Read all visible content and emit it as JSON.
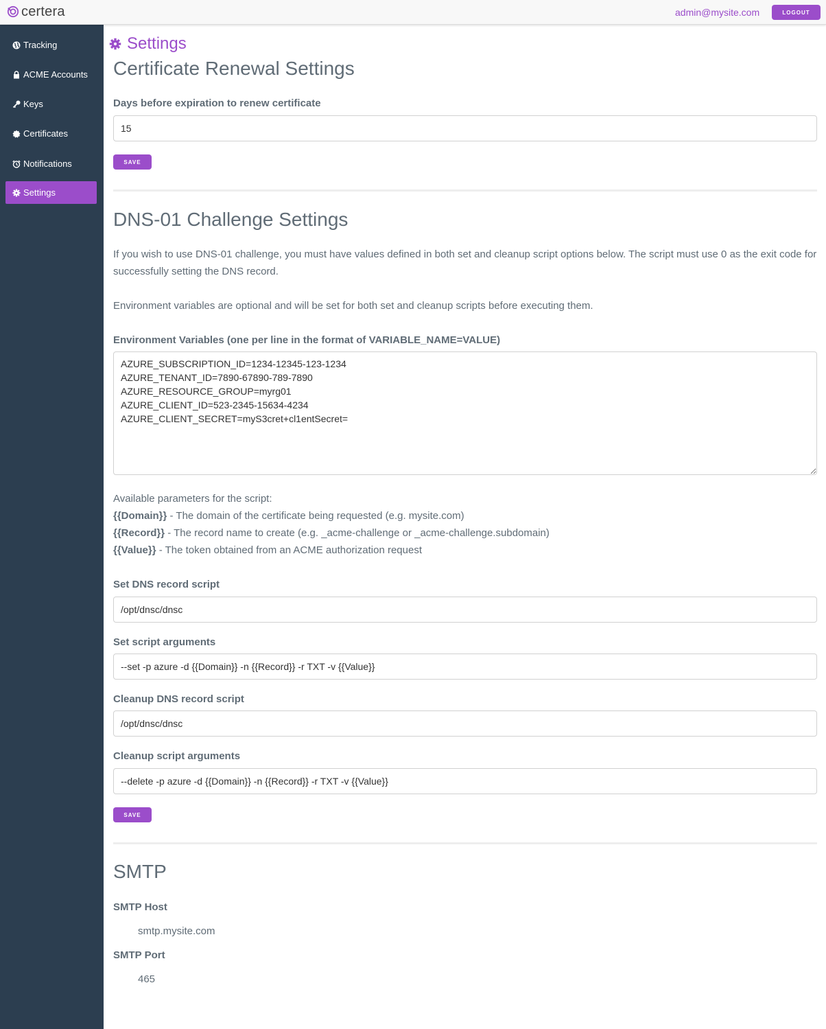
{
  "header": {
    "brand": "certera",
    "user_email": "admin@mysite.com",
    "logout_label": "LOGOUT"
  },
  "sidebar": {
    "items": [
      {
        "label": "Tracking",
        "icon": "globe-icon"
      },
      {
        "label": "ACME Accounts",
        "icon": "lock-icon"
      },
      {
        "label": "Keys",
        "icon": "key-icon"
      },
      {
        "label": "Certificates",
        "icon": "certificate-icon"
      },
      {
        "label": "Notifications",
        "icon": "alarm-clock-icon"
      },
      {
        "label": "Settings",
        "icon": "gear-icon",
        "active": true
      }
    ]
  },
  "page": {
    "title": "Settings",
    "renewal": {
      "heading": "Certificate Renewal Settings",
      "days_label": "Days before expiration to renew certificate",
      "days_value": "15",
      "save_label": "SAVE"
    },
    "dns": {
      "heading": "DNS-01 Challenge Settings",
      "intro": "If you wish to use DNS-01 challenge, you must have values defined in both set and cleanup script options below. The script must use 0 as the exit code for successfully setting the DNS record.",
      "env_note": "Environment variables are optional and will be set for both set and cleanup scripts before executing them.",
      "env_label": "Environment Variables (one per line in the format of VARIABLE_NAME=VALUE)",
      "env_value": "AZURE_SUBSCRIPTION_ID=1234-12345-123-1234\nAZURE_TENANT_ID=7890-67890-789-7890\nAZURE_RESOURCE_GROUP=myrg01\nAZURE_CLIENT_ID=523-2345-15634-4234\nAZURE_CLIENT_SECRET=myS3cret+cl1entSecret=",
      "params_heading": "Available parameters for the script:",
      "params": [
        {
          "name": "{{Domain}}",
          "desc": " - The domain of the certificate being requested (e.g. mysite.com)"
        },
        {
          "name": "{{Record}}",
          "desc": " - The record name to create (e.g. _acme-challenge or _acme-challenge.subdomain)"
        },
        {
          "name": "{{Value}}",
          "desc": " - The token obtained from an ACME authorization request"
        }
      ],
      "set_script_label": "Set DNS record script",
      "set_script_value": "/opt/dnsc/dnsc",
      "set_args_label": "Set script arguments",
      "set_args_value": "--set -p azure -d {{Domain}} -n {{Record}} -r TXT -v {{Value}}",
      "cleanup_script_label": "Cleanup DNS record script",
      "cleanup_script_value": "/opt/dnsc/dnsc",
      "cleanup_args_label": "Cleanup script arguments",
      "cleanup_args_value": "--delete -p azure -d {{Domain}} -n {{Record}} -r TXT -v {{Value}}",
      "save_label": "SAVE"
    },
    "smtp": {
      "heading": "SMTP",
      "host_label": "SMTP Host",
      "host_value": "smtp.mysite.com",
      "port_label": "SMTP Port",
      "port_value": "465"
    }
  },
  "colors": {
    "accent": "#9b4dca",
    "sidebar_bg": "#2c3e50",
    "text": "#606c76"
  }
}
